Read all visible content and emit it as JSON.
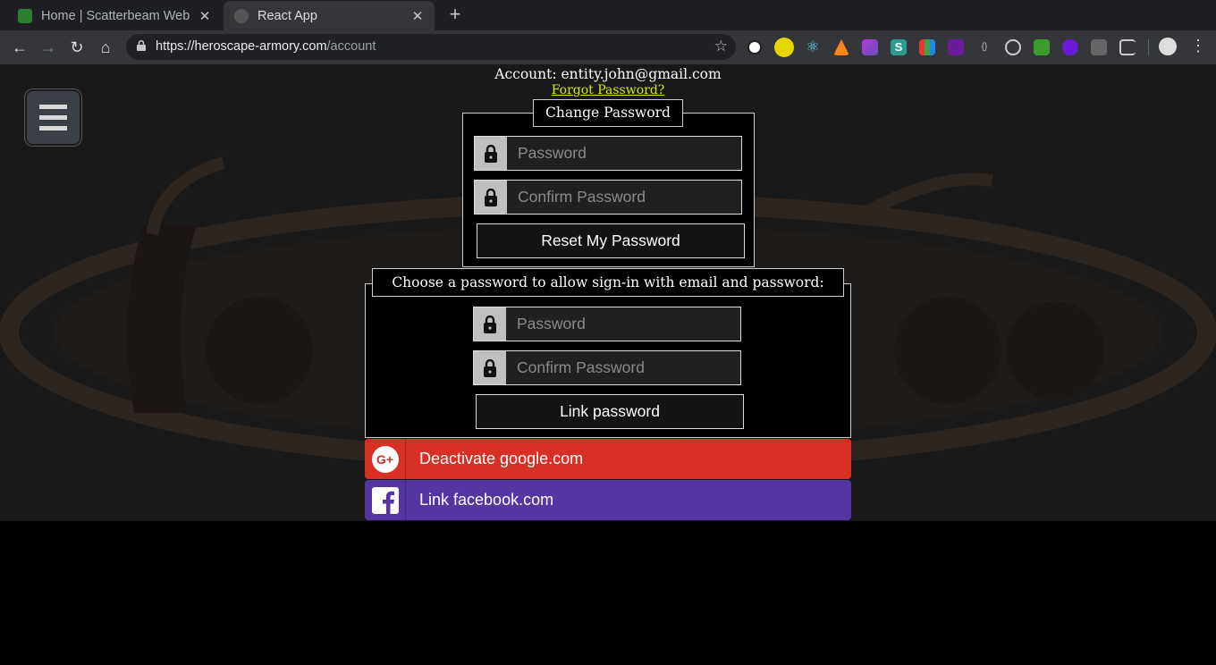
{
  "browser": {
    "tabs": [
      {
        "title": "Home | Scatterbeam Web",
        "active": false
      },
      {
        "title": "React App",
        "active": true
      }
    ],
    "url_host": "https://heroscape-armory.com",
    "url_path": "/account",
    "icons": [
      "back-icon",
      "forward-icon",
      "reload-icon",
      "home-icon",
      "star-icon",
      "menu-icon"
    ]
  },
  "account": {
    "heading": "Account: entity.john@gmail.com",
    "forgot_link": "Forgot Password?"
  },
  "change_password": {
    "legend": "Change Password",
    "password_placeholder": "Password",
    "confirm_placeholder": "Confirm Password",
    "submit_label": "Reset My Password"
  },
  "link_password": {
    "legend": "Choose a password to allow sign-in with email and password:",
    "password_placeholder": "Password",
    "confirm_placeholder": "Confirm Password",
    "submit_label": "Link password"
  },
  "providers": {
    "google_label": "Deactivate google.com",
    "google_color": "#d93025",
    "facebook_label": "Link facebook.com",
    "facebook_color": "#5536a0"
  },
  "colors": {
    "link": "#d7ea11",
    "page_bg": "#1a1919"
  }
}
